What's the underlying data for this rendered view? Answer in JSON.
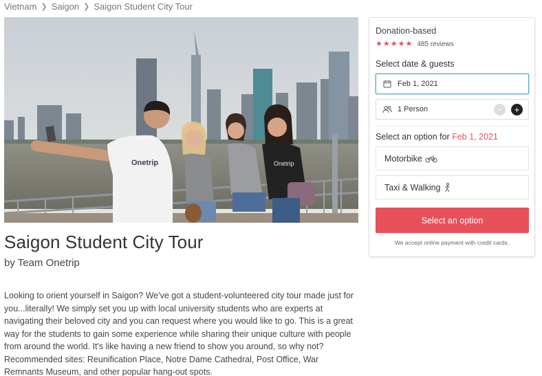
{
  "breadcrumb": [
    "Vietnam",
    "Saigon",
    "Saigon Student City Tour"
  ],
  "hero": {
    "shirt_text": "Onetrip"
  },
  "tour": {
    "title": "Saigon Student City Tour",
    "byline": "by Team Onetrip",
    "description": "Looking to orient yourself in Saigon? We've got a student-volunteered city tour made just for you...literally! We simply set you up with local university students who are experts at navigating their beloved city and you can request where you would like to go. This is a great way for the students to gain some experience while sharing their unique culture with people from around the world. It's like having a new friend to show you around, so why not? Recommended sites: Reunification Place, Notre Dame Cathedral, Post Office, War Remnants Museum, and other popular hang-out spots."
  },
  "booking": {
    "price_label": "Donation-based",
    "rating_stars": 5,
    "reviews": "485 reviews",
    "date_guests_label": "Select date & guests",
    "date_value": "Feb 1, 2021",
    "guests_value": "1 Person",
    "option_label_prefix": "Select an option for",
    "option_label_date": "Feb 1, 2021",
    "options": [
      {
        "label": "Motorbike",
        "icon": "motorbike-icon"
      },
      {
        "label": "Taxi & Walking",
        "icon": "walking-icon"
      }
    ],
    "cta": "Select an option",
    "payment_note": "We accept online payment with credit cards."
  },
  "colors": {
    "accent": "#e8505b",
    "focus": "#5aa9c4"
  }
}
